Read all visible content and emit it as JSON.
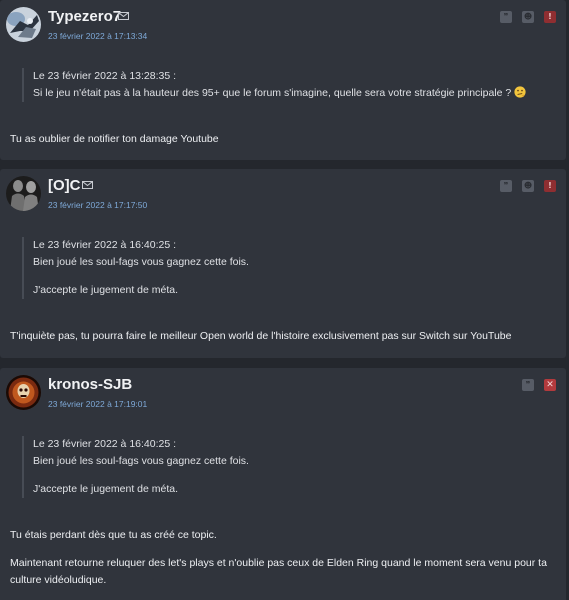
{
  "posts": [
    {
      "author": "Typezero7",
      "timestamp": "23 février 2022 à 17:13:34",
      "quote": {
        "header": "Le 23 février 2022 à 13:28:35 :",
        "lines": [
          "Si le jeu n'était pas à la hauteur des 95+ que le forum s'imagine, quelle sera votre stratégie principale ?"
        ],
        "emoji": "thinking-smiley"
      },
      "message": [
        "Tu as oublier de notifier ton damage Youtube"
      ],
      "actions": [
        "quote-icon",
        "profile-icon",
        "report-icon"
      ]
    },
    {
      "author": "[O]C",
      "timestamp": "23 février 2022 à 17:17:50",
      "quote": {
        "header": "Le 23 février 2022 à 16:40:25 :",
        "lines": [
          "Bien joué les soul-fags vous gagnez cette fois.",
          "J'accepte le jugement de méta."
        ]
      },
      "message": [
        "T'inquiète pas, tu pourra faire le meilleur Open world de l'histoire exclusivement pas sur Switch sur YouTube"
      ],
      "actions": [
        "quote-icon",
        "profile-icon",
        "report-icon"
      ]
    },
    {
      "author": "kronos-SJB",
      "timestamp": "23 février 2022 à 17:19:01",
      "quote": {
        "header": "Le 23 février 2022 à 16:40:25 :",
        "lines": [
          "Bien joué les soul-fags vous gagnez cette fois.",
          "J'accepte le jugement de méta."
        ]
      },
      "message": [
        "Tu étais perdant dès que tu as créé ce topic.",
        "Maintenant retourne reluquer des let's plays et n'oublie pas ceux de Elden Ring quand le moment sera venu pour ta culture vidéoludique."
      ],
      "actions": [
        "quote-icon",
        "delete-icon"
      ]
    }
  ],
  "colors": {
    "background": "#24272d",
    "card": "#30343c",
    "timestamp": "#7ea9d8",
    "report": "#8f2e31",
    "delete": "#b23a3d"
  }
}
